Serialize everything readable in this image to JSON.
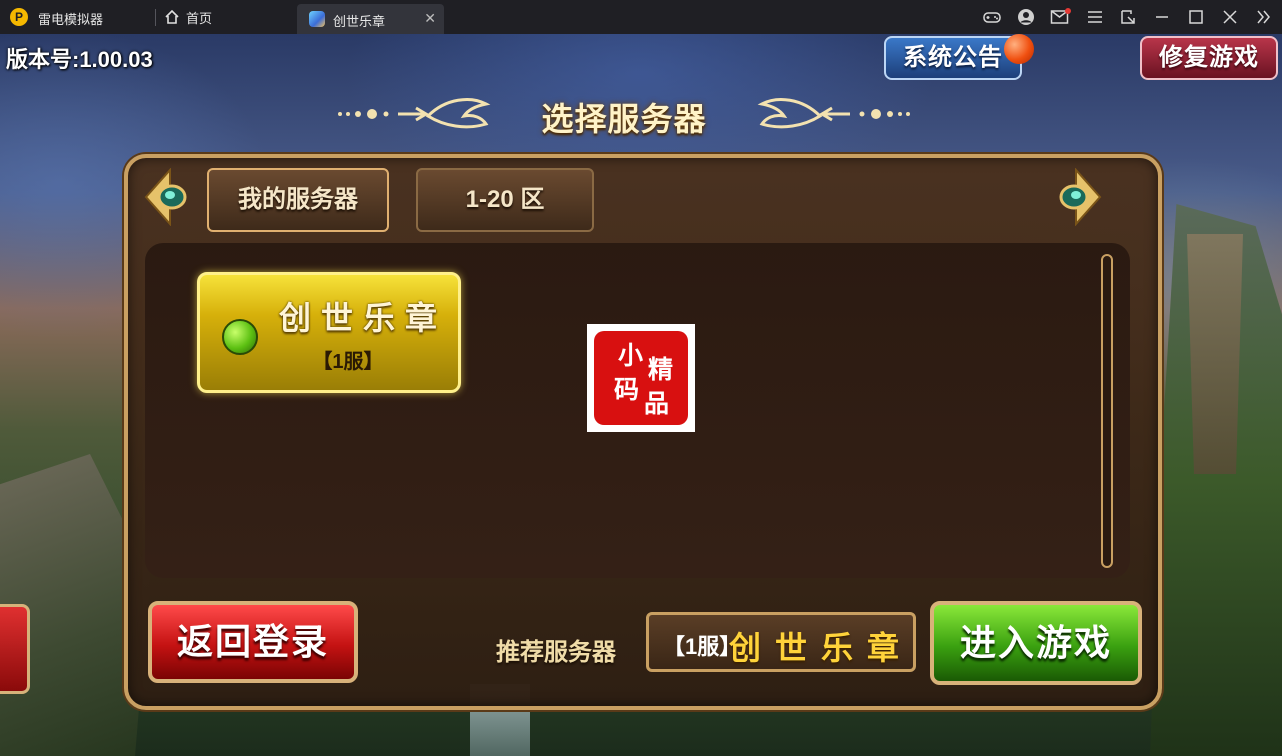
{
  "window": {
    "app_name": "雷电模拟器",
    "tabs": [
      {
        "label": "首页",
        "icon": "home-icon"
      },
      {
        "label": "创世乐章",
        "icon": "game-icon",
        "active": true
      }
    ],
    "toolbar_icons": [
      "gamepad-icon",
      "user-icon",
      "mail-icon",
      "menu-icon",
      "resize-icon",
      "minimize-icon",
      "maximize-icon",
      "close-icon",
      "expand-icon"
    ],
    "mail_badge_color": "#e53935"
  },
  "game": {
    "version": "版本号:1.00.03",
    "notice_button": "系统公告",
    "repair_button": "修复游戏",
    "title": "选择服务器",
    "tabs": {
      "my_servers": "我的服务器",
      "range": "1-20 区"
    },
    "server": {
      "name": "创世乐章",
      "sub": "【1服】",
      "status_color": "#5cc012"
    },
    "seal": [
      "小",
      "码",
      "精",
      "品"
    ],
    "back_button": "返回登录",
    "recommend_label": "推荐服务器",
    "recommend": {
      "sub": "【1服】",
      "name": "创世乐章"
    },
    "enter_button": "进入游戏"
  }
}
